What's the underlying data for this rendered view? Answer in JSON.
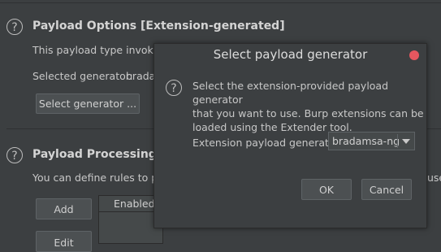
{
  "options": {
    "title": "Payload Options [Extension-generated]",
    "description": "This payload type invokes",
    "selected_label": "Selected generator:",
    "selected_value": "bradam",
    "select_button": "Select generator ..."
  },
  "processing": {
    "title": "Payload Processing",
    "description": "You can define rules to per",
    "right_fragment": "use",
    "add_button": "Add",
    "edit_button": "Edit",
    "table_column": "Enabled"
  },
  "dialog": {
    "title": "Select payload generator",
    "message": [
      "Select the extension-provided payload generator",
      "that you want to use. Burp extensions can be",
      "loaded using the Extender tool."
    ],
    "generator_label": "Extension payload generator:",
    "generator_value": "bradamsa-ng",
    "ok_button": "OK",
    "cancel_button": "Cancel",
    "close_color": "#e5575f"
  },
  "icons": {
    "help": "?"
  }
}
